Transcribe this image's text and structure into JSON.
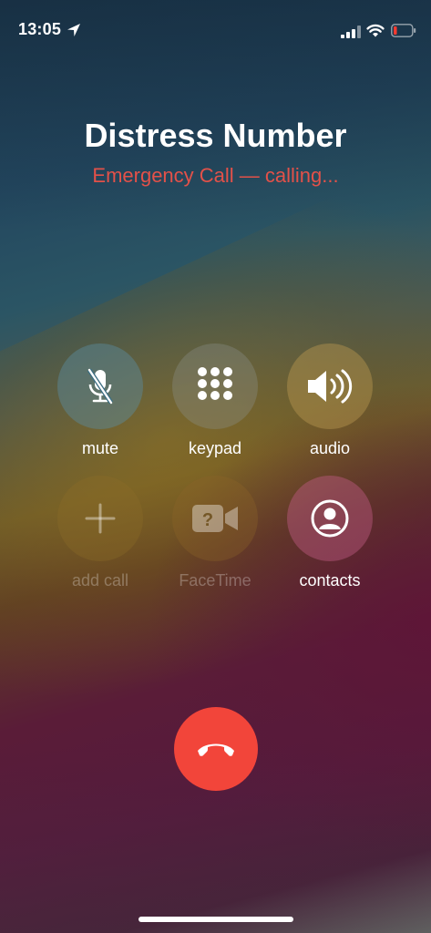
{
  "status_bar": {
    "time": "13:05",
    "icons": [
      "location-icon",
      "signal-icon",
      "wifi-icon",
      "battery-icon"
    ]
  },
  "call": {
    "caller_name": "Distress Number",
    "status": "Emergency Call — calling..."
  },
  "controls": {
    "mute": {
      "label": "mute",
      "icon": "mic-slash-icon"
    },
    "keypad": {
      "label": "keypad",
      "icon": "keypad-grid-icon"
    },
    "audio": {
      "label": "audio",
      "icon": "speaker-icon"
    },
    "add_call": {
      "label": "add call",
      "icon": "plus-icon"
    },
    "facetime": {
      "label": "FaceTime",
      "icon": "video-question-icon"
    },
    "contacts": {
      "label": "contacts",
      "icon": "person-circle-icon"
    }
  },
  "end_call": {
    "icon": "phone-hangup-icon"
  },
  "colors": {
    "end_call": "#f2453a",
    "status_text": "#e35149",
    "battery_low": "#ff3b30"
  }
}
